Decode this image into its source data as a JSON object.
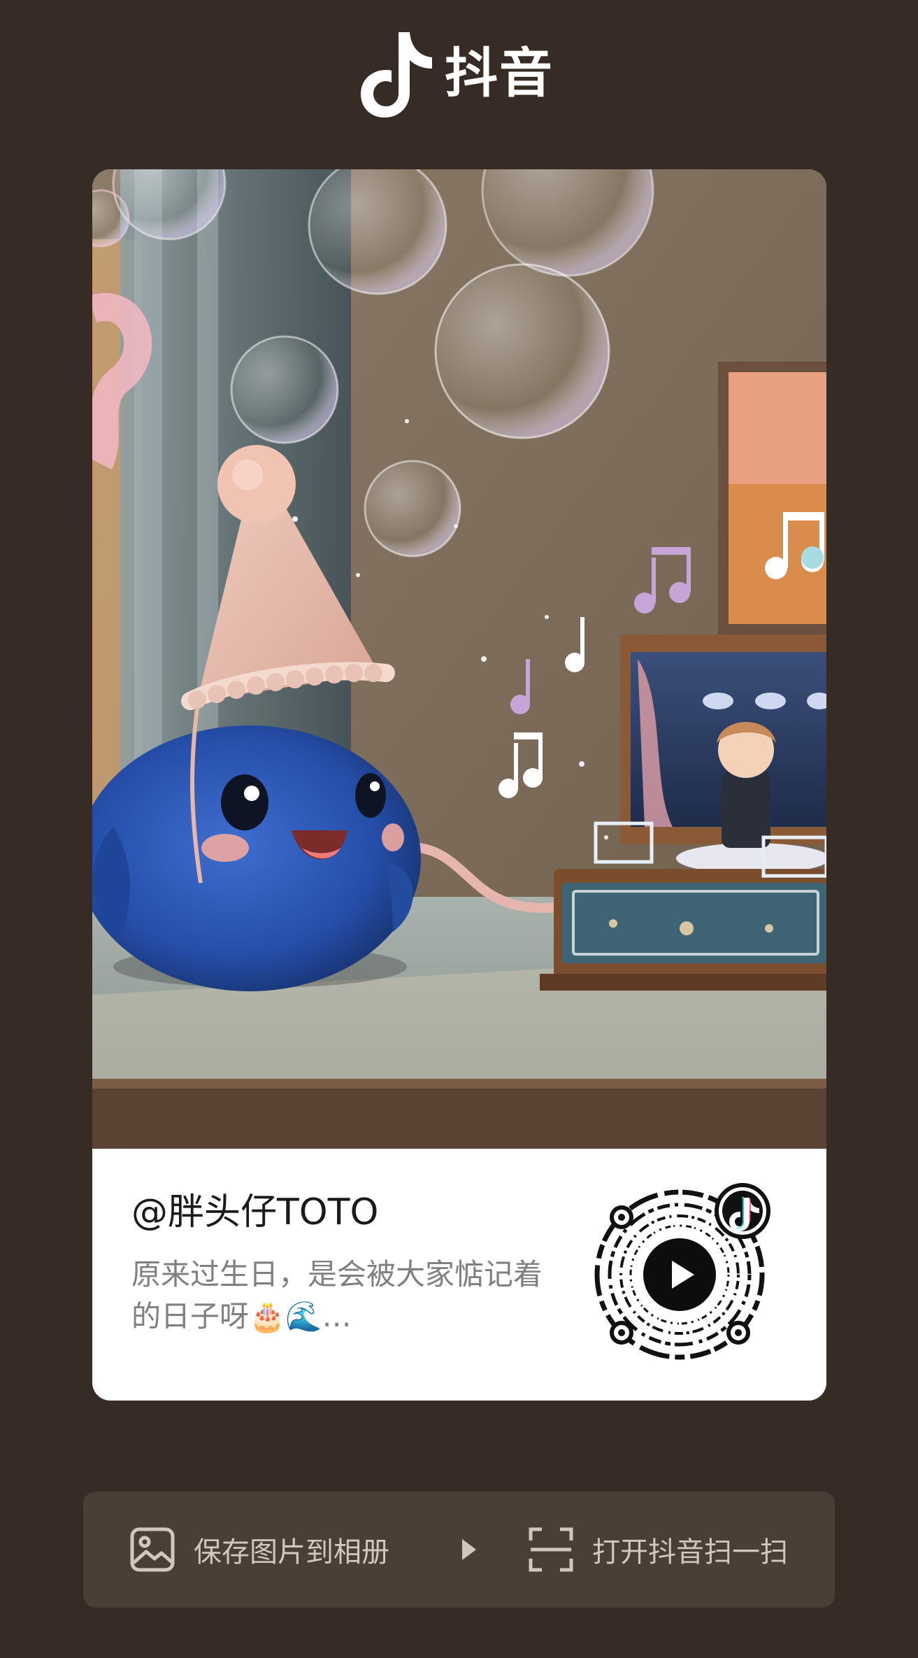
{
  "header": {
    "brand_name": "抖音",
    "logo_icon": "tiktok-note-icon"
  },
  "post": {
    "author": "@胖头仔TOTO",
    "caption": "原来过生日，是会被大家惦记着的日子呀🎂🌊…",
    "qr_icon": "qr-code-icon",
    "play_icon": "play-icon"
  },
  "actions": {
    "save_label": "保存图片到相册",
    "save_icon": "image-icon",
    "arrow_icon": "triangle-right-icon",
    "scan_label": "打开抖音扫一扫",
    "scan_icon": "scan-icon"
  },
  "colors": {
    "background": "#372c25",
    "action_bar": "#4a3f37",
    "card": "#ffffff",
    "author_text": "#1a1a1a",
    "caption_text": "#808080",
    "action_text": "#cfc7c0"
  }
}
